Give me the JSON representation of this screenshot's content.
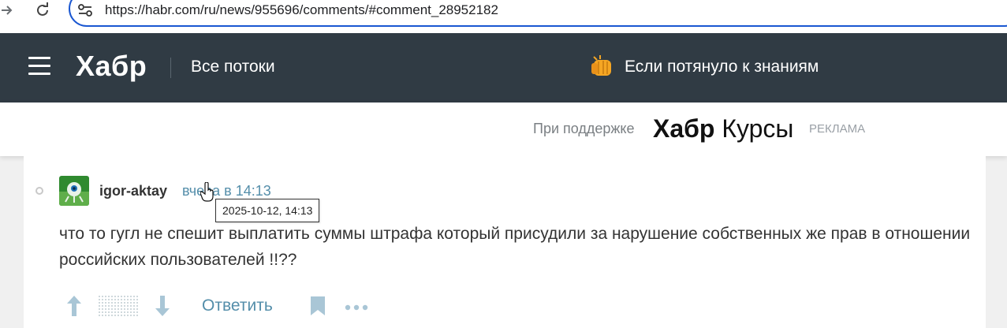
{
  "browser": {
    "url": "https://habr.com/ru/news/955696/comments/#comment_28952182"
  },
  "header": {
    "logo": "Хабр",
    "flows_label": "Все потоки",
    "promo_text": "Если потянуло к знаниям"
  },
  "support": {
    "label": "При поддержке",
    "logo_bold": "Хабр",
    "logo_regular": "Курсы",
    "ad_label": "РЕКЛАМА"
  },
  "comment": {
    "author": "igor-aktay",
    "time": "вчера в 14:13",
    "tooltip": "2025-10-12, 14:13",
    "text": "что то гугл не спешит выплатить суммы штрафа который присудили за нарушение собственных же прав в отношении российских пользователей !!??",
    "reply_label": "Ответить"
  },
  "colors": {
    "header_bg": "#303b44",
    "link": "#548eaa",
    "address_focus": "#1a57d1"
  }
}
